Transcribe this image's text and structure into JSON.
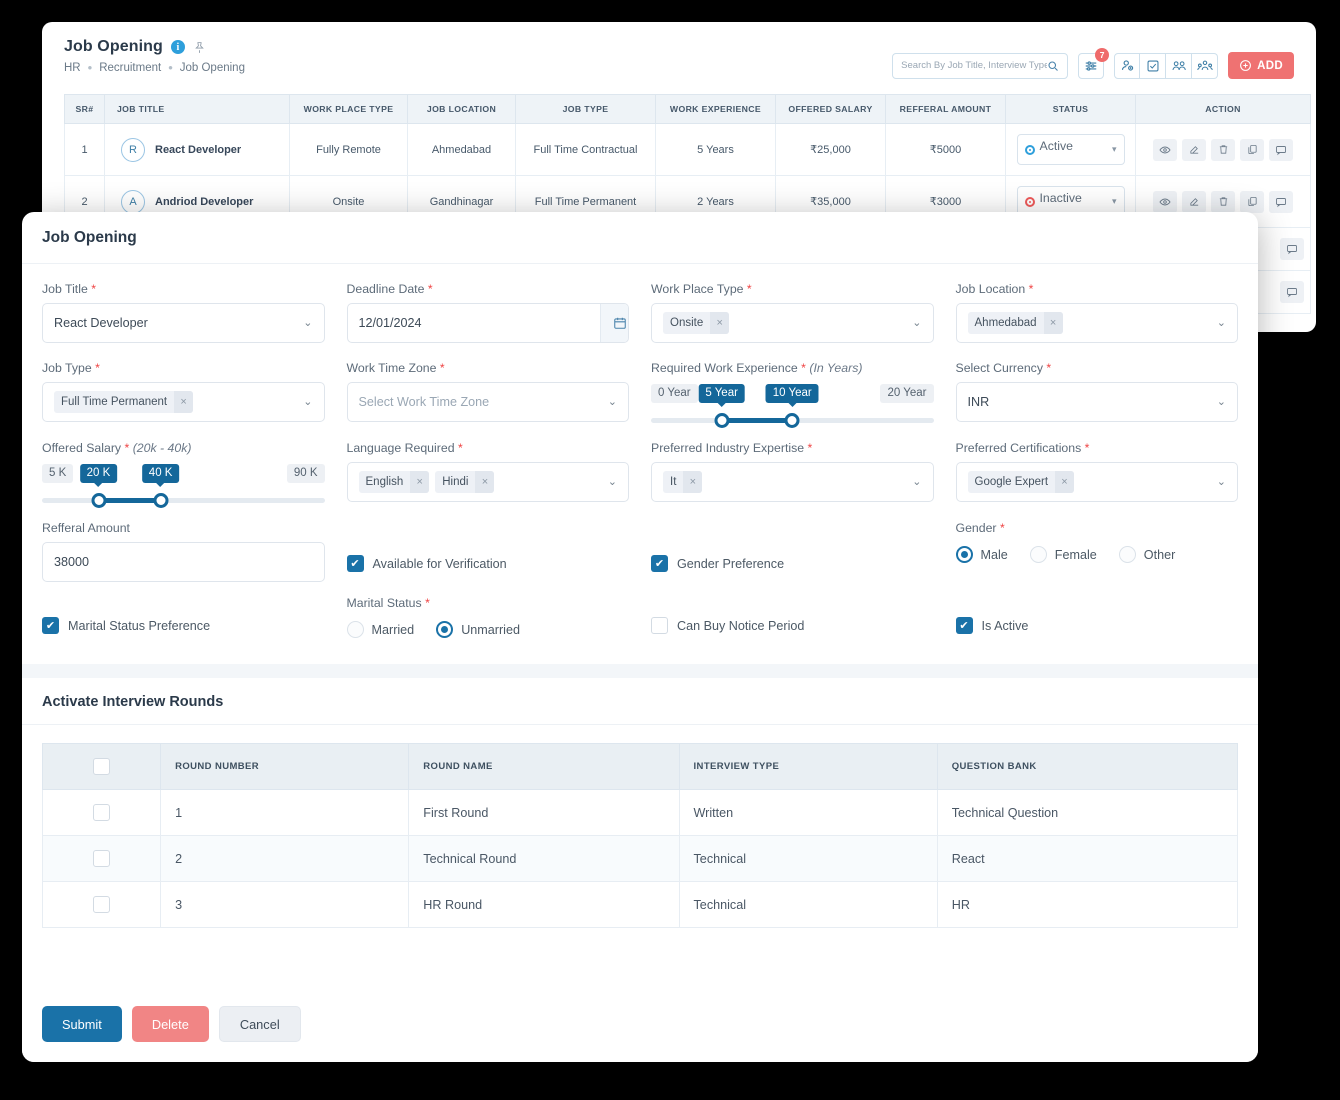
{
  "background": {
    "title": "Job Opening",
    "breadcrumb": [
      "HR",
      "Recruitment",
      "Job Opening"
    ],
    "search": {
      "placeholder": "Search By Job Title, Interview Type,"
    },
    "filter_badge": "7",
    "add_label": "ADD",
    "table": {
      "columns": [
        "SR#",
        "JOB TITLE",
        "WORK PLACE TYPE",
        "JOB LOCATION",
        "JOB TYPE",
        "WORK EXPERIENCE",
        "OFFERED SALARY",
        "REFFERAL AMOUNT",
        "STATUS",
        "ACTION"
      ],
      "rows": [
        {
          "sr": "1",
          "initial": "R",
          "job_title": "React Developer",
          "work_place_type": "Fully Remote",
          "job_location": "Ahmedabad",
          "job_type": "Full Time Contractual",
          "work_experience": "5 Years",
          "offered_salary": "₹25,000",
          "refferal_amount": "₹5000",
          "status": "Active",
          "status_color": "#2e9fdb"
        },
        {
          "sr": "2",
          "initial": "A",
          "job_title": "Andriod Developer",
          "work_place_type": "Onsite",
          "job_location": "Gandhinagar",
          "job_type": "Full Time Permanent",
          "work_experience": "2 Years",
          "offered_salary": "₹35,000",
          "refferal_amount": "₹3000",
          "status": "Inactive",
          "status_color": "#ef5a5a"
        }
      ]
    }
  },
  "modal": {
    "title": "Job Opening",
    "fields": {
      "job_title": {
        "label": "Job Title",
        "required": true,
        "value": "React Developer"
      },
      "deadline_date": {
        "label": "Deadline Date",
        "required": true,
        "value": "12/01/2024"
      },
      "work_place_type": {
        "label": "Work Place Type",
        "required": true,
        "chips": [
          "Onsite"
        ]
      },
      "job_location": {
        "label": "Job Location",
        "required": true,
        "chips": [
          "Ahmedabad"
        ]
      },
      "job_type": {
        "label": "Job Type",
        "required": true,
        "chips": [
          "Full Time Permanent"
        ]
      },
      "work_time_zone": {
        "label": "Work Time Zone",
        "required": true,
        "placeholder": "Select Work Time Zone"
      },
      "required_work_experience": {
        "label": "Required Work Experience",
        "required": true,
        "hint": "(In Years)",
        "min_label": "0 Year",
        "max_label": "20 Year",
        "low_label": "5 Year",
        "high_label": "10 Year",
        "min": 0,
        "max": 20,
        "low": 5,
        "high": 10
      },
      "select_currency": {
        "label": "Select Currency",
        "required": true,
        "value": "INR"
      },
      "offered_salary": {
        "label": "Offered Salary",
        "required": true,
        "hint": "(20k - 40k)",
        "min_label": "5 K",
        "max_label": "90 K",
        "low_label": "20 K",
        "high_label": "40 K",
        "min": 5,
        "max": 90,
        "low": 20,
        "high": 40
      },
      "language_required": {
        "label": "Language Required",
        "required": true,
        "chips": [
          "English",
          "Hindi"
        ]
      },
      "preferred_industry_expertise": {
        "label": "Preferred Industry Expertise",
        "required": true,
        "chips": [
          "It"
        ]
      },
      "preferred_certifications": {
        "label": "Preferred Certifications",
        "required": true,
        "chips": [
          "Google Expert"
        ]
      },
      "refferal_amount": {
        "label": "Refferal Amount",
        "required": false,
        "value": "38000"
      }
    },
    "toggles": {
      "available_for_verification": {
        "label": "Available for Verification",
        "checked": true
      },
      "gender_preference": {
        "label": "Gender Preference",
        "checked": true
      },
      "marital_status_preference": {
        "label": "Marital Status Preference",
        "checked": true
      },
      "can_buy_notice_period": {
        "label": "Can Buy Notice Period",
        "checked": false
      },
      "is_active": {
        "label": "Is Active",
        "checked": true
      }
    },
    "gender": {
      "label": "Gender",
      "required": true,
      "options": [
        "Male",
        "Female",
        "Other"
      ],
      "selected": "Male"
    },
    "marital_status": {
      "label": "Marital Status",
      "required": true,
      "options": [
        "Married",
        "Unmarried"
      ],
      "selected": "Unmarried"
    },
    "rounds": {
      "title": "Activate Interview Rounds",
      "columns": [
        "",
        "ROUND NUMBER",
        "ROUND NAME",
        "INTERVIEW TYPE",
        "QUESTION BANK"
      ],
      "select_all_checked": false,
      "rows": [
        {
          "checked": false,
          "round_number": "1",
          "round_name": "First Round",
          "interview_type": "Written",
          "question_bank": "Technical Question"
        },
        {
          "checked": false,
          "round_number": "2",
          "round_name": "Technical Round",
          "interview_type": "Technical",
          "question_bank": "React"
        },
        {
          "checked": false,
          "round_number": "3",
          "round_name": "HR Round",
          "interview_type": "Technical",
          "question_bank": "HR"
        }
      ]
    },
    "footer": {
      "submit": "Submit",
      "delete": "Delete",
      "cancel": "Cancel"
    }
  },
  "colors": {
    "accent_blue": "#1a72a8",
    "slider_blue": "#14679a",
    "danger": "#ef7272",
    "link": "#3b7fb0"
  }
}
